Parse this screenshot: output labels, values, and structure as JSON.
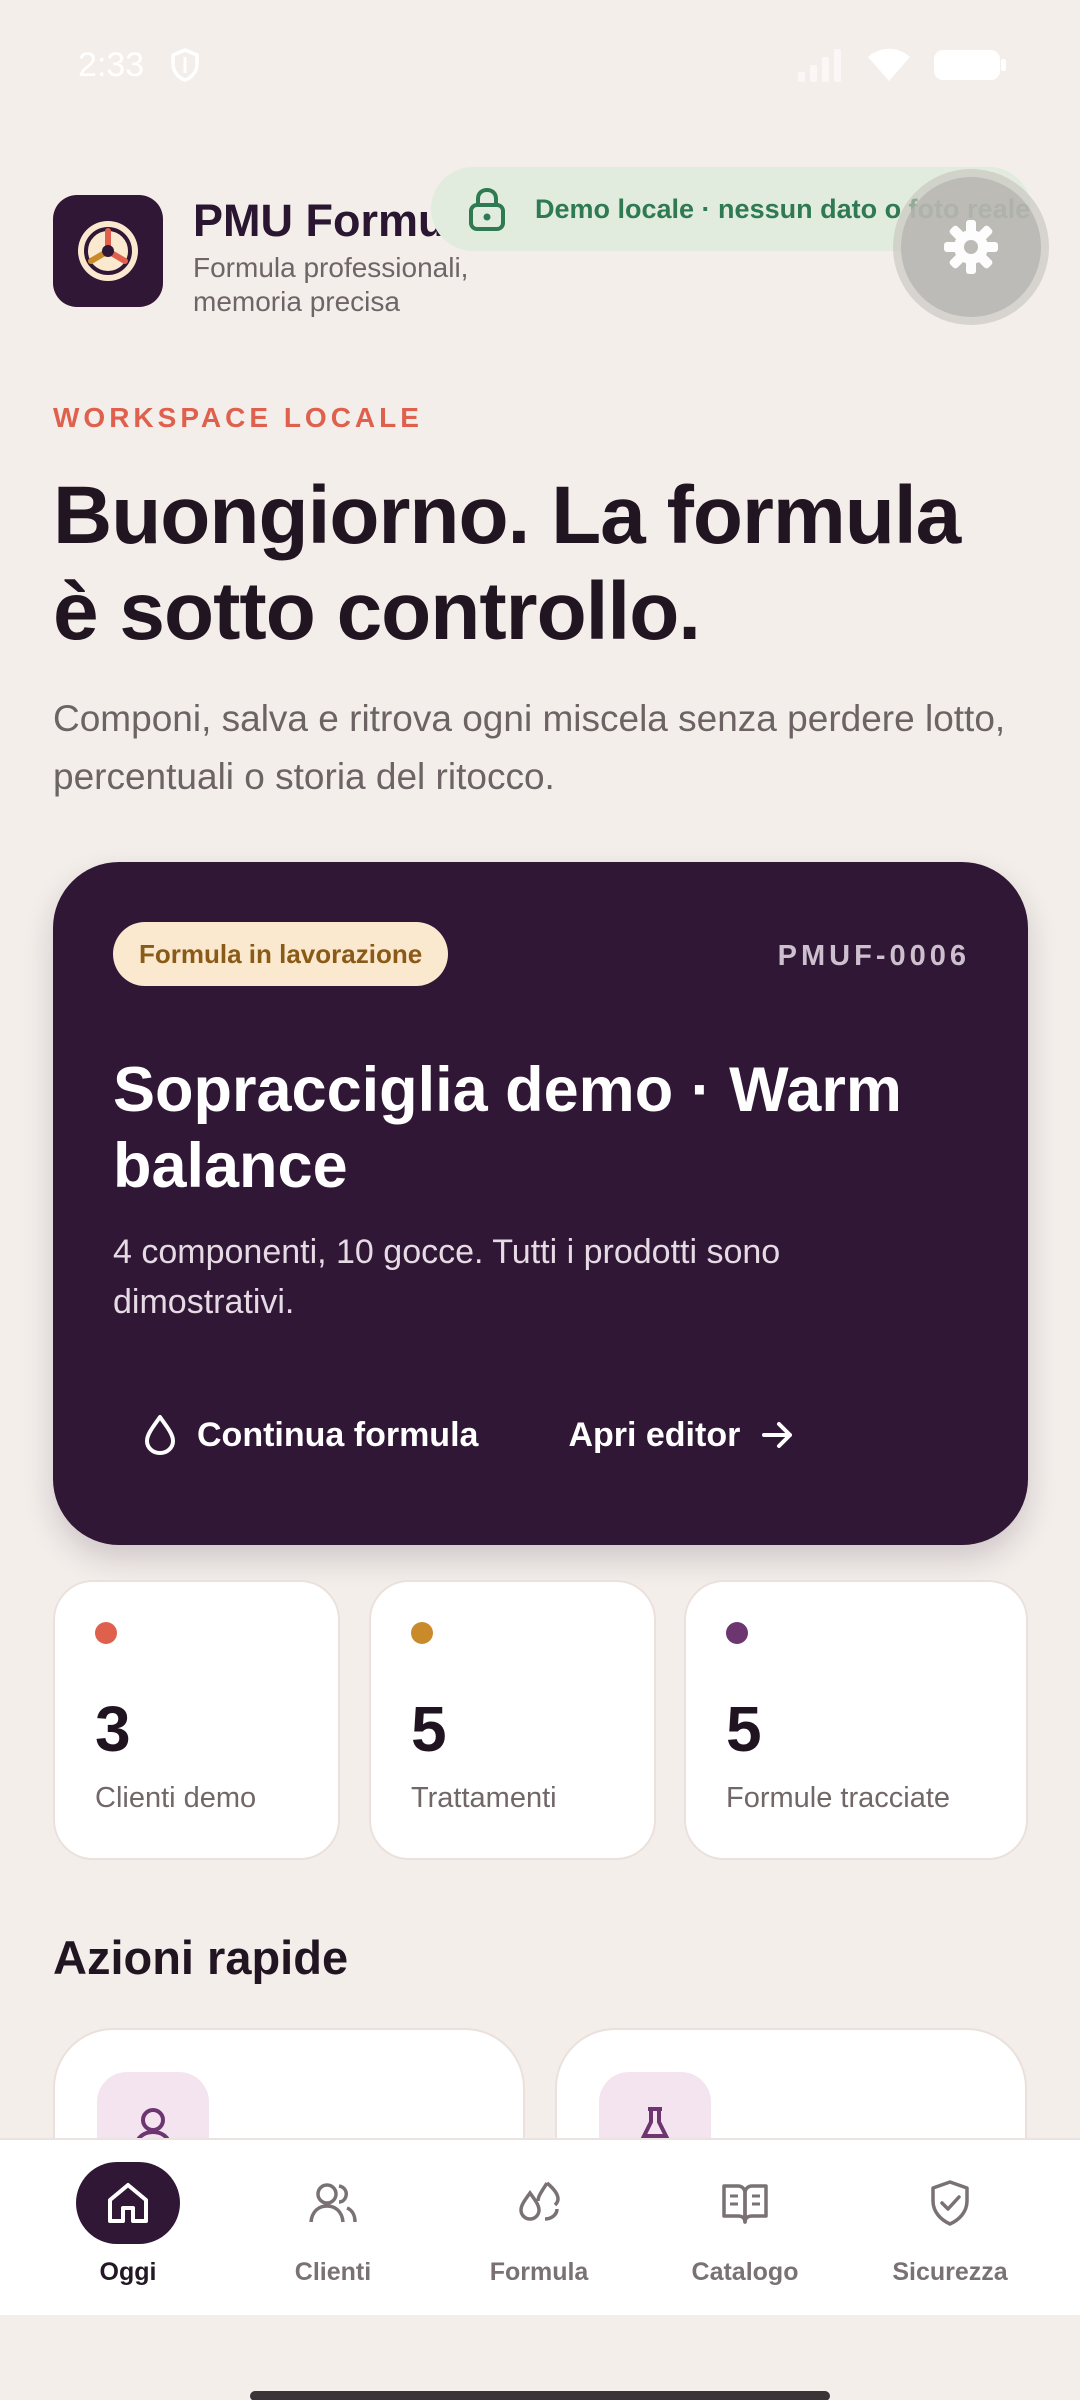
{
  "status_bar": {
    "time": "2:33"
  },
  "header": {
    "title": "PMU Formul",
    "subtitle": "Formula professionali, memoria precisa",
    "demo_banner": "Demo locale · nessun dato o foto reale"
  },
  "hero": {
    "eyebrow": "WORKSPACE LOCALE",
    "headline": "Buongiorno. La formula è sotto controllo.",
    "intro": "Componi, salva e ritrova ogni miscela senza perdere lotto, percentuali o storia del ritocco."
  },
  "formula_card": {
    "badge": "Formula in lavorazione",
    "code": "PMUF-0006",
    "title": "Sopracciglia demo · Warm balance",
    "description": "4 componenti, 10 gocce. Tutti i prodotti sono dimostrativi.",
    "continue_label": "Continua formula",
    "editor_label": "Apri editor"
  },
  "stats": [
    {
      "value": "3",
      "label": "Clienti demo",
      "color": "#e0604e"
    },
    {
      "value": "5",
      "label": "Trattamenti",
      "color": "#c98a2a"
    },
    {
      "value": "5",
      "label": "Formule tracciate",
      "color": "#6e3670"
    }
  ],
  "quick_actions": {
    "title": "Azioni rapide",
    "items": [
      {
        "icon": "user-icon"
      },
      {
        "icon": "flask-icon"
      }
    ]
  },
  "bottom_nav": [
    {
      "label": "Oggi",
      "icon": "home-icon",
      "active": true
    },
    {
      "label": "Clienti",
      "icon": "users-icon",
      "active": false
    },
    {
      "label": "Formula",
      "icon": "drops-icon",
      "active": false
    },
    {
      "label": "Catalogo",
      "icon": "book-icon",
      "active": false
    },
    {
      "label": "Sicurezza",
      "icon": "shield-check-icon",
      "active": false
    }
  ],
  "colors": {
    "brand": "#301736",
    "accent": "#e0604e",
    "background": "#f3eeea",
    "demo_banner": "#e1ecdf"
  }
}
